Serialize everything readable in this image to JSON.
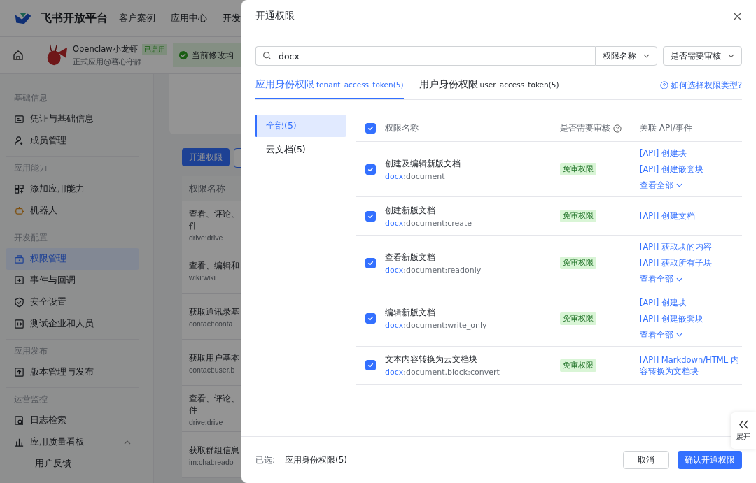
{
  "header": {
    "logo": "飞书开放平台",
    "nav": [
      "客户案例",
      "应用中心",
      "开发"
    ]
  },
  "app_bar": {
    "name": "Openclaw小龙虾",
    "status": "已启用",
    "subtitle": "正式应用@蕃心守静",
    "notice": "当前修改均"
  },
  "sidebar": {
    "sections": [
      {
        "title": "基础信息",
        "items": [
          {
            "label": "凭证与基础信息",
            "selected": false
          },
          {
            "label": "成员管理",
            "selected": false
          }
        ]
      },
      {
        "title": "应用能力",
        "items": [
          {
            "label": "添加应用能力",
            "selected": false
          },
          {
            "label": "机器人",
            "selected": false
          }
        ]
      },
      {
        "title": "开发配置",
        "items": [
          {
            "label": "权限管理",
            "selected": true
          },
          {
            "label": "事件与回调",
            "selected": false
          },
          {
            "label": "安全设置",
            "selected": false
          },
          {
            "label": "测试企业和人员",
            "selected": false
          }
        ]
      },
      {
        "title": "应用发布",
        "items": [
          {
            "label": "版本管理与发布",
            "selected": false
          }
        ]
      },
      {
        "title": "运营监控",
        "items": [
          {
            "label": "日志检索",
            "selected": false
          },
          {
            "label": "应用质量看板",
            "selected": false,
            "expanded": true,
            "children": [
              {
                "label": "用户反馈"
              }
            ]
          }
        ]
      }
    ]
  },
  "background": {
    "primary_button": "开通权限",
    "column": "权限名称",
    "rows": [
      {
        "lines": [
          "查看、评论、",
          "件"
        ],
        "scope": "drive:drive"
      },
      {
        "lines": [
          "查看、编辑和"
        ],
        "scope": "wiki:wiki"
      },
      {
        "lines": [
          "获取通讯录基"
        ],
        "scope": "contact:conta"
      },
      {
        "lines": [
          "获取用户基本"
        ],
        "scope": "contact:user.b"
      },
      {
        "lines": [
          "查看、评论、",
          "件"
        ],
        "scope": "drive:drive"
      },
      {
        "lines": [
          "获取群组信息"
        ],
        "scope": "im:chat:reado"
      }
    ]
  },
  "modal": {
    "title": "开通权限",
    "search": {
      "value": "docx",
      "filters": [
        "权限名称",
        "是否需要审核"
      ]
    },
    "tabs": [
      {
        "label": "应用身份权限",
        "token": "tenant_access_token(5)",
        "selected": true
      },
      {
        "label": "用户身份权限",
        "token": "user_access_token(5)",
        "selected": false
      }
    ],
    "help_link": "如何选择权限类型?",
    "categories": [
      {
        "label": "全部(5)",
        "selected": true
      },
      {
        "label": "云文档(5)",
        "selected": false
      }
    ],
    "table": {
      "all_checked": true,
      "columns": [
        "权限名称",
        "是否需要审核",
        "关联 API/事件"
      ],
      "rows": [
        {
          "checked": true,
          "name": "创建及编辑新版文档",
          "scope_prefix": "docx",
          "scope": ":document",
          "badge": "免审权限",
          "apis": [
            "[API] 创建块",
            "[API] 创建嵌套块"
          ],
          "more": "查看全部"
        },
        {
          "checked": true,
          "name": "创建新版文档",
          "scope_prefix": "docx",
          "scope": ":document:create",
          "badge": "免审权限",
          "apis": [
            "[API] 创建文档"
          ]
        },
        {
          "checked": true,
          "name": "查看新版文档",
          "scope_prefix": "docx",
          "scope": ":document:readonly",
          "badge": "免审权限",
          "apis": [
            "[API] 获取块的内容",
            "[API] 获取所有子块"
          ],
          "more": "查看全部"
        },
        {
          "checked": true,
          "name": "编辑新版文档",
          "scope_prefix": "docx",
          "scope": ":document:write_only",
          "badge": "免审权限",
          "apis": [
            "[API] 创建块",
            "[API] 创建嵌套块"
          ],
          "more": "查看全部"
        },
        {
          "checked": true,
          "name": "文本内容转换为云文档块",
          "scope_prefix": "docx",
          "scope": ":document.block:convert",
          "badge": "免审权限",
          "apis": [
            "[API] Markdown/HTML 内容转换为文档块"
          ]
        }
      ]
    },
    "expand_tab": "展开",
    "footer": {
      "label": "已选:",
      "selection": "应用身份权限(5)",
      "buttons": [
        "取消",
        "确认开通权限"
      ]
    }
  }
}
